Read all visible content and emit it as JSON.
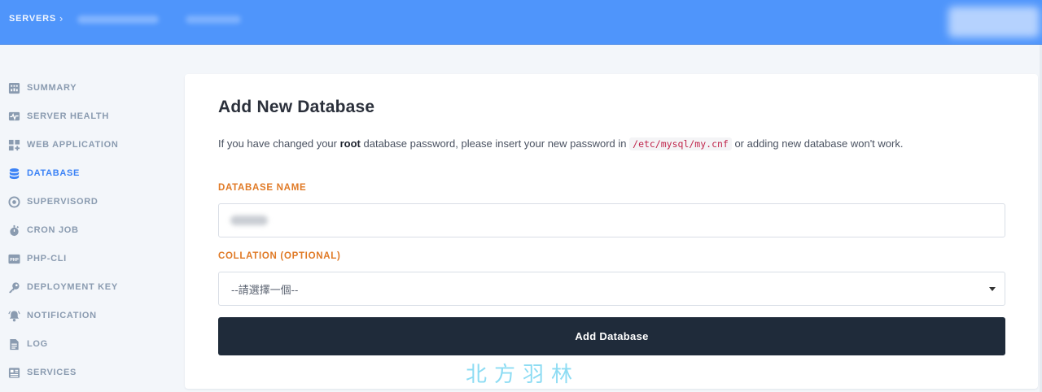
{
  "header": {
    "breadcrumb_root": "SERVERS",
    "breadcrumb_sep": "›"
  },
  "sidebar": {
    "items": [
      {
        "label": "SUMMARY",
        "icon": "summary-icon",
        "active": false
      },
      {
        "label": "SERVER HEALTH",
        "icon": "server-health-icon",
        "active": false
      },
      {
        "label": "WEB APPLICATION",
        "icon": "web-application-icon",
        "active": false
      },
      {
        "label": "DATABASE",
        "icon": "database-icon",
        "active": true
      },
      {
        "label": "SUPERVISORD",
        "icon": "supervisord-icon",
        "active": false
      },
      {
        "label": "CRON JOB",
        "icon": "cron-job-icon",
        "active": false
      },
      {
        "label": "PHP-CLI",
        "icon": "php-icon",
        "active": false
      },
      {
        "label": "DEPLOYMENT KEY",
        "icon": "key-icon",
        "active": false
      },
      {
        "label": "NOTIFICATION",
        "icon": "bell-icon",
        "active": false
      },
      {
        "label": "LOG",
        "icon": "log-icon",
        "active": false
      },
      {
        "label": "SERVICES",
        "icon": "services-icon",
        "active": false
      }
    ]
  },
  "form": {
    "title": "Add New Database",
    "desc_before": "If you have changed your ",
    "desc_bold": "root",
    "desc_middle": " database password, please insert your new password in ",
    "desc_code": "/etc/mysql/my.cnf",
    "desc_after": " or adding new database won't work.",
    "db_name_label": "DATABASE NAME",
    "collation_label": "COLLATION (OPTIONAL)",
    "collation_selected": "--請選擇一個--",
    "submit_label": "Add Database"
  },
  "watermark": "北方羽林",
  "colors": {
    "header_bg": "#4f95fb",
    "active_nav": "#3b82f6",
    "nav_text": "#8a9bb0",
    "label_orange": "#e07a26",
    "button_bg": "#1f2b3a"
  }
}
